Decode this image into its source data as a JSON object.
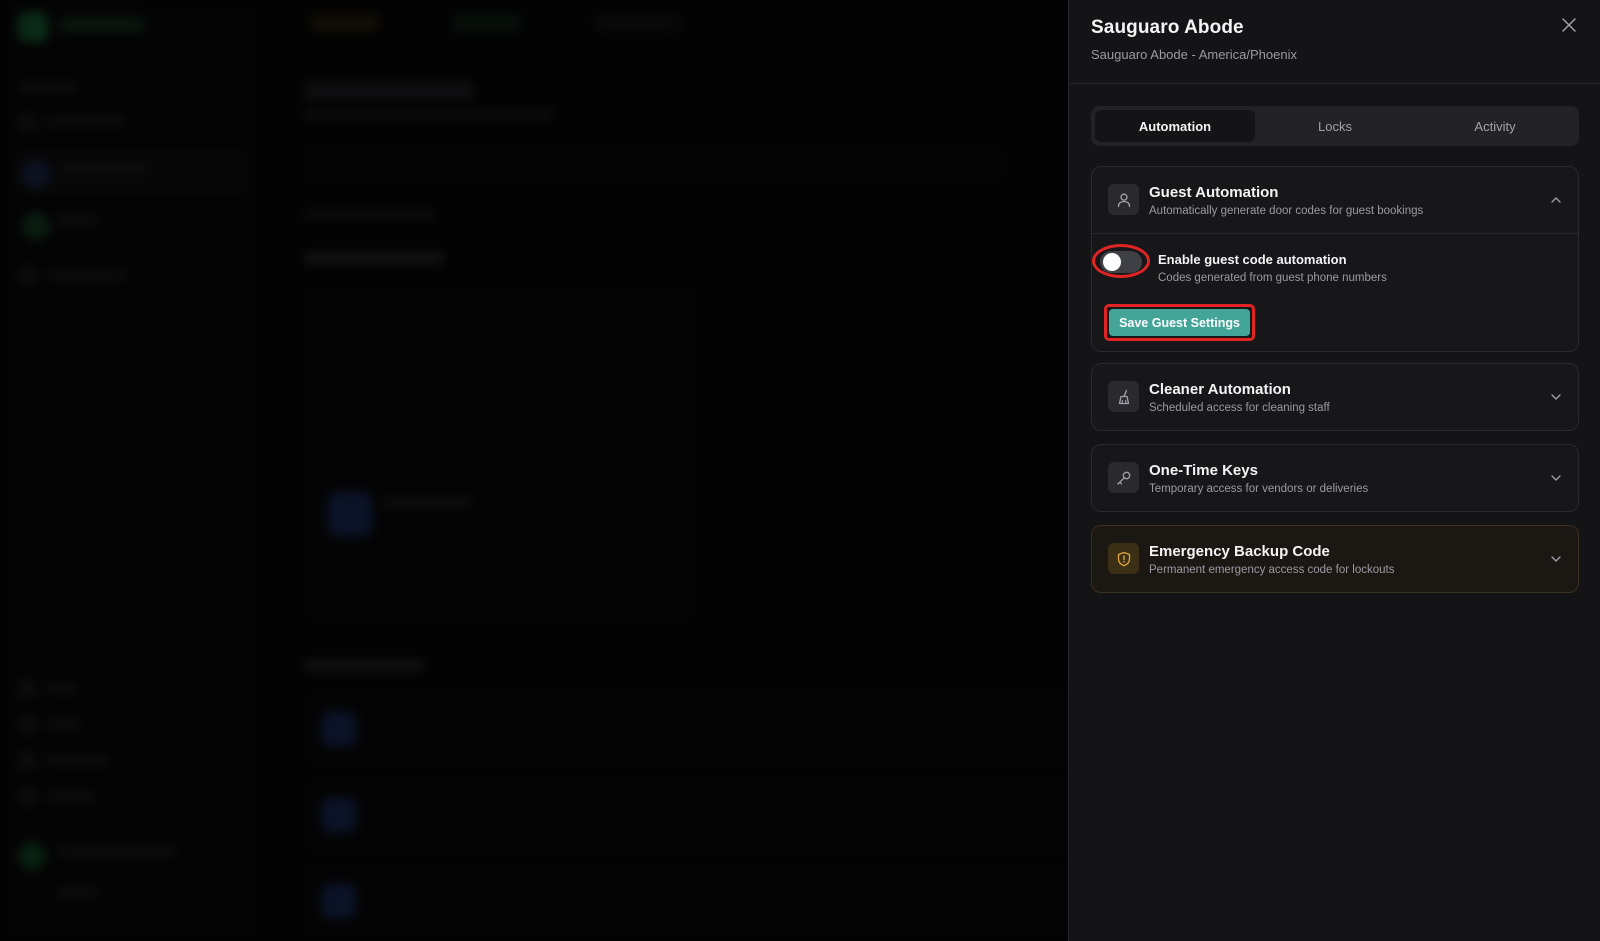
{
  "panel": {
    "title": "Sauguaro Abode",
    "subtitle": "Sauguaro Abode - America/Phoenix"
  },
  "tabs": [
    {
      "label": "Automation",
      "active": true
    },
    {
      "label": "Locks",
      "active": false
    },
    {
      "label": "Activity",
      "active": false
    }
  ],
  "sections": {
    "guest": {
      "title": "Guest Automation",
      "description": "Automatically generate door codes for guest bookings",
      "expanded": true,
      "toggle_label": "Enable guest code automation",
      "toggle_description": "Codes generated from guest phone numbers",
      "toggle_on": false,
      "save_label": "Save Guest Settings"
    },
    "cleaner": {
      "title": "Cleaner Automation",
      "description": "Scheduled access for cleaning staff",
      "expanded": false
    },
    "one_time": {
      "title": "One-Time Keys",
      "description": "Temporary access for vendors or deliveries",
      "expanded": false
    },
    "emergency": {
      "title": "Emergency Backup Code",
      "description": "Permanent emergency access code for lockouts",
      "expanded": false
    }
  },
  "colors": {
    "accent": "#43a597",
    "highlight": "#e02424",
    "warning": "#e0a83a"
  },
  "icons": {
    "close": "close-icon",
    "guest": "user-icon",
    "cleaner": "broom-icon",
    "one_time": "key-icon",
    "emergency": "shield-alert-icon"
  }
}
